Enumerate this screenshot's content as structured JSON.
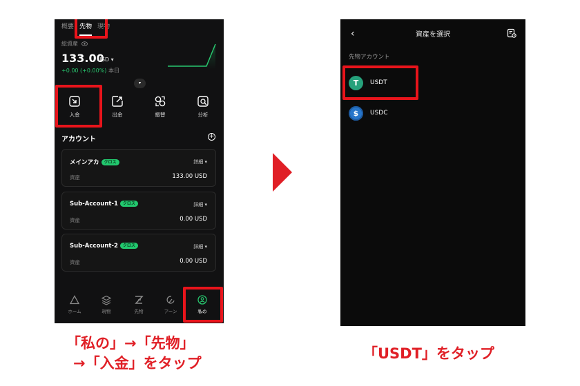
{
  "left_phone": {
    "tabs": [
      "概要",
      "先物",
      "現物"
    ],
    "active_tab": "先物",
    "balance_label": "総資産",
    "balance_value": "133.00",
    "balance_unit": "USD ▾",
    "pnl": "+0.00 (+0.00%)",
    "pnl_period": "本日",
    "expand_icon": "▾",
    "quick_actions": [
      {
        "label": "入金",
        "icon": "deposit-icon"
      },
      {
        "label": "出金",
        "icon": "withdraw-icon"
      },
      {
        "label": "振替",
        "icon": "transfer-icon"
      },
      {
        "label": "分析",
        "icon": "analysis-icon"
      }
    ],
    "section_title": "アカウント",
    "section_plus": "+",
    "accounts": [
      {
        "name": "メインアカ",
        "badge": "クロス",
        "detail": "詳細 ▾",
        "label": "資産",
        "value": "133.00 USD"
      },
      {
        "name": "Sub-Account-1",
        "badge": "クロス",
        "detail": "詳細 ▾",
        "label": "資産",
        "value": "0.00 USD"
      },
      {
        "name": "Sub-Account-2",
        "badge": "クロス",
        "detail": "詳細 ▾",
        "label": "資産",
        "value": "0.00 USD"
      }
    ],
    "bottom_nav": [
      {
        "label": "ホーム",
        "icon": "home-icon"
      },
      {
        "label": "現物",
        "icon": "layers-icon"
      },
      {
        "label": "先物",
        "icon": "futures-icon"
      },
      {
        "label": "アーン",
        "icon": "earn-icon"
      },
      {
        "label": "私の",
        "icon": "profile-icon"
      }
    ],
    "active_nav": "私の"
  },
  "right_phone": {
    "back_icon": "‹",
    "title": "資産を選択",
    "section": "先物アカウント",
    "assets": [
      {
        "name": "USDT",
        "symbol": "T",
        "color": "#26a17b"
      },
      {
        "name": "USDC",
        "symbol": "$",
        "color": "#2775ca"
      }
    ]
  },
  "captions": {
    "left_line1": "「私の」→「先物」",
    "left_line2": "→「入金」をタップ",
    "right": "「USDT」をタップ"
  },
  "colors": {
    "highlight": "#e8141b",
    "caption": "#e01f26",
    "positive": "#28c76f",
    "badge": "#22c86e"
  }
}
